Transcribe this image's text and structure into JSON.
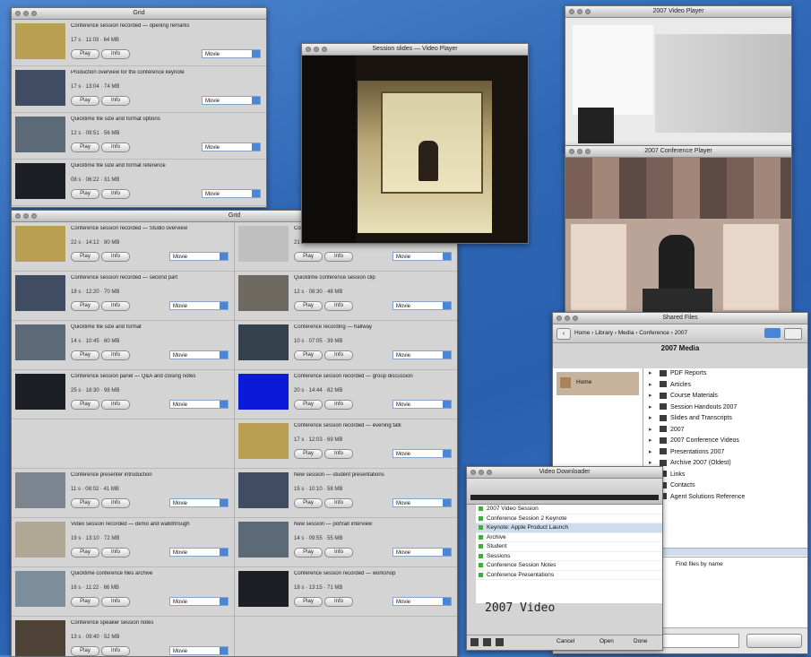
{
  "windows": {
    "top_left": {
      "title": "Grid"
    },
    "big_list": {
      "title": "Grid"
    },
    "center_player": {
      "title": "Session slides — Video Player"
    },
    "right_top_player": {
      "title": "2007 Video Player"
    },
    "right_mid_player": {
      "title": "2007 Conference Player"
    },
    "finder": {
      "title": "Shared Files",
      "path": "Home › Library › Media › Conference › 2007",
      "center_label": "2007 Media"
    },
    "itunes": {
      "title": "Video Downloader",
      "big_text": "2007 Video",
      "buttons": [
        "Cancel",
        "Open",
        "Done"
      ]
    }
  },
  "top_left_rows": [
    {
      "title": "Conference session recorded — opening remarks",
      "meta": "17 s · 11:03 · 64 MB",
      "btn1": "Play",
      "btn2": "Info",
      "select": "Movie"
    },
    {
      "title": "Production overview for the conference keynote",
      "meta": "17 s · 13:04 · 74 MB",
      "btn1": "Play",
      "btn2": "Info",
      "select": "Movie"
    },
    {
      "title": "Quicktime file size and format options",
      "meta": "12 s · 09:51 · 56 MB",
      "btn1": "Play",
      "btn2": "Info",
      "select": "Movie"
    },
    {
      "title": "Quicktime file size and format reference",
      "meta": "08 s · 06:22 · 31 MB",
      "btn1": "Play",
      "btn2": "Info",
      "select": "Movie"
    }
  ],
  "left_column_rows": [
    {
      "title": "Conference session recorded — Studio overview",
      "meta": "22 s · 14:12 · 80 MB",
      "btn1": "Play",
      "btn2": "Info",
      "select": "Movie"
    },
    {
      "title": "Conference session recorded — second part",
      "meta": "18 s · 12:20 · 70 MB",
      "btn1": "Play",
      "btn2": "Info",
      "select": "Movie"
    },
    {
      "title": "Quicktime file size and format",
      "meta": "14 s · 10:45 · 60 MB",
      "btn1": "Play",
      "btn2": "Info",
      "select": "Movie"
    },
    {
      "title": "Conference session panel — Q&A and closing notes",
      "meta": "25 s · 18:30 · 98 MB",
      "btn1": "Play",
      "btn2": "Info",
      "select": "Movie"
    },
    {
      "title": "",
      "meta": "",
      "btn1": "",
      "btn2": "",
      "select": ""
    },
    {
      "title": "Conference presenter introduction",
      "meta": "11 s · 08:02 · 41 MB",
      "btn1": "Play",
      "btn2": "Info",
      "select": "Movie"
    },
    {
      "title": "Video session recorded — demo and walkthrough",
      "meta": "19 s · 13:10 · 72 MB",
      "btn1": "Play",
      "btn2": "Info",
      "select": "Movie"
    },
    {
      "title": "Quicktime conference files archive",
      "meta": "16 s · 11:22 · 66 MB",
      "btn1": "Play",
      "btn2": "Info",
      "select": "Movie"
    },
    {
      "title": "Conference speaker session notes",
      "meta": "13 s · 09:40 · 52 MB",
      "btn1": "Play",
      "btn2": "Info",
      "select": "Movie"
    }
  ],
  "right_column_rows": [
    {
      "title": "Conference session recorded — audience view",
      "meta": "21 s · 15:00 · 84 MB",
      "btn1": "Play",
      "btn2": "Info",
      "select": "Movie"
    },
    {
      "title": "Quicktime conference session clip",
      "meta": "12 s · 08:30 · 48 MB",
      "btn1": "Play",
      "btn2": "Info",
      "select": "Movie"
    },
    {
      "title": "Conference recording — hallway",
      "meta": "10 s · 07:05 · 39 MB",
      "btn1": "Play",
      "btn2": "Info",
      "select": "Movie"
    },
    {
      "title": "Conference session recorded — group discussion",
      "meta": "20 s · 14:44 · 82 MB",
      "btn1": "Play",
      "btn2": "Info",
      "select": "Movie"
    },
    {
      "title": "Conference session recorded — evening talk",
      "meta": "17 s · 12:03 · 69 MB",
      "btn1": "Play",
      "btn2": "Info",
      "select": "Movie"
    },
    {
      "title": "New session — student presentations",
      "meta": "15 s · 10:10 · 58 MB",
      "btn1": "Play",
      "btn2": "Info",
      "select": "Movie"
    },
    {
      "title": "New session — portrait interview",
      "meta": "14 s · 09:55 · 55 MB",
      "btn1": "Play",
      "btn2": "Info",
      "select": "Movie"
    },
    {
      "title": "Conference session recorded — workshop",
      "meta": "18 s · 13:15 · 71 MB",
      "btn1": "Play",
      "btn2": "Info",
      "select": "Movie"
    }
  ],
  "finder_tree": [
    "PDF Reports",
    "Articles",
    "Course Materials",
    "Session Handouts 2007",
    "Slides and Transcripts",
    "2007",
    "2007 Conference Videos",
    "Presentations 2007",
    "Archive 2007 (Oldest)",
    "Links",
    "Contacts",
    "Agent Solutions Reference"
  ],
  "finder_sidebar": {
    "item": "Home"
  },
  "finder_search_text": "Find files by name",
  "itunes_list": [
    "2007 Video Session",
    "Conference Session 2 Keynote",
    "Keynote: Apple Product Launch",
    "Archive",
    "Student",
    "Sessions",
    "Conference Session Notes",
    "Conference Presentations"
  ],
  "colors": {
    "desktop": "#2f67b5",
    "chrome": "#d4d4d4",
    "select_accent": "#4a86d8"
  }
}
